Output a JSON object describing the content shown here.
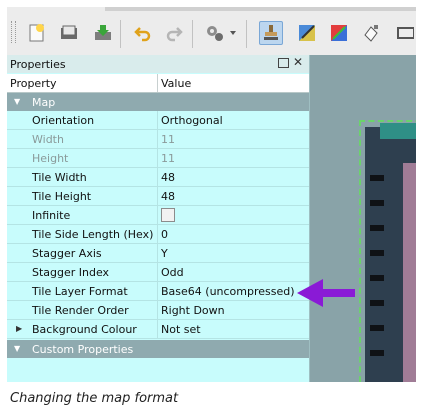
{
  "panel": {
    "title": "Properties",
    "columns": {
      "property": "Property",
      "value": "Value"
    }
  },
  "map_group": {
    "label": "Map"
  },
  "rows": [
    {
      "name": "Orientation",
      "value": "Orthogonal"
    },
    {
      "name": "Width",
      "value": "11"
    },
    {
      "name": "Height",
      "value": "11"
    },
    {
      "name": "Tile Width",
      "value": "48"
    },
    {
      "name": "Tile Height",
      "value": "48"
    },
    {
      "name": "Infinite",
      "value": ""
    },
    {
      "name": "Tile Side Length (Hex)",
      "value": "0"
    },
    {
      "name": "Stagger Axis",
      "value": "Y"
    },
    {
      "name": "Stagger Index",
      "value": "Odd"
    },
    {
      "name": "Tile Layer Format",
      "value": "Base64 (uncompressed)"
    },
    {
      "name": "Tile Render Order",
      "value": "Right Down"
    },
    {
      "name": "Background Colour",
      "value": "Not set"
    }
  ],
  "custom_group": {
    "label": "Custom Properties"
  },
  "caption": "Changing the map format",
  "colors": {
    "panel_bg": "#c8fcfc",
    "group_bg": "#8faaaf",
    "arrow": "#8a1ad6"
  },
  "icons": [
    "new-map-icon",
    "open-icon",
    "save-icon",
    "undo-icon",
    "redo-icon",
    "commands-icon",
    "stamp-brush-icon",
    "terrain-brush-icon",
    "bucket-fill-icon",
    "eraser-icon"
  ]
}
